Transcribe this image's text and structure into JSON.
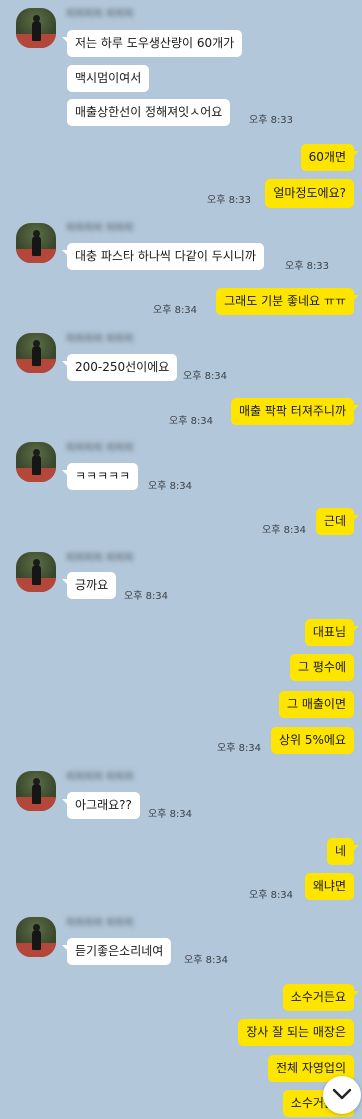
{
  "messages": {
    "m1": "저는 하루 도우생산량이 60개가",
    "m2": "맥시멈이여서",
    "m3": "매출상한선이 정해져잇ㅅ어요",
    "t1": "오후 8:33",
    "m4": "60개면",
    "m5": "얼마정도에요?",
    "t2": "오후 8:33",
    "m6": "대충 파스타 하나씩 다같이 두시니까",
    "t3": "오후 8:33",
    "m7": "그래도 기분 좋네요 ㅠㅠ",
    "t4": "오후 8:34",
    "m8": "200-250선이에요",
    "t5": "오후 8:34",
    "m9": "매출 팍팍 터져주니까",
    "t6": "오후 8:34",
    "m10": "ㅋㅋㅋㅋㅋ",
    "t7": "오후 8:34",
    "m11": "근데",
    "t8": "오후 8:34",
    "m12": "긍까요",
    "t9": "오후 8:34",
    "m13": "대표님",
    "m14": "그 평수에",
    "m15": "그 매출이면",
    "m16": "상위 5%에요",
    "t10": "오후 8:34",
    "m17": "아그래요??",
    "t11": "오후 8:34",
    "m18": "네",
    "m19": "왜냐면",
    "t12": "오후 8:34",
    "m20": "듣기좋은소리네여",
    "t13": "오후 8:34",
    "m21": "소수거든요",
    "m22": "장사 잘 되는 매장은",
    "m23": "전체 자영업의",
    "m24": "소수거든요"
  },
  "contact": {
    "name_blurred": "피피피피 피피피"
  },
  "colors": {
    "background": "#b2c7d9",
    "outgoing": "#fee500",
    "incoming": "#ffffff"
  },
  "icons": {
    "scroll_down": "chevron-down-icon"
  }
}
